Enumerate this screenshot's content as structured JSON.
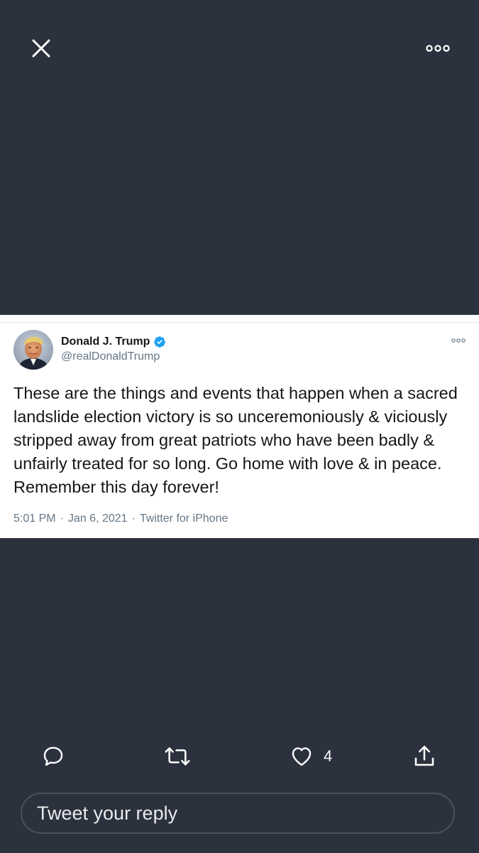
{
  "viewer": {
    "close_icon": "close-icon",
    "more_icon": "more-horizontal-icon",
    "background_color": "#2b313d"
  },
  "tweet": {
    "author_name": "Donald J. Trump",
    "author_handle": "@realDonaldTrump",
    "verified": true,
    "text": "These are the things and events that happen when a sacred landslide election victory is so unceremoniously & viciously stripped away from great patriots who have been badly & unfairly treated for so long. Go home with love & in peace. Remember this day forever!",
    "time": "5:01 PM",
    "date": "Jan 6, 2021",
    "source": "Twitter for iPhone",
    "separator": "·"
  },
  "actions": {
    "reply_icon": "reply-icon",
    "retweet_icon": "retweet-icon",
    "like_icon": "heart-icon",
    "like_count": "4",
    "share_icon": "share-icon"
  },
  "reply": {
    "placeholder": "Tweet your reply"
  },
  "colors": {
    "accent": "#1da1f2",
    "verified_badge": "#1da1f2",
    "secondary_text": "#657786"
  }
}
